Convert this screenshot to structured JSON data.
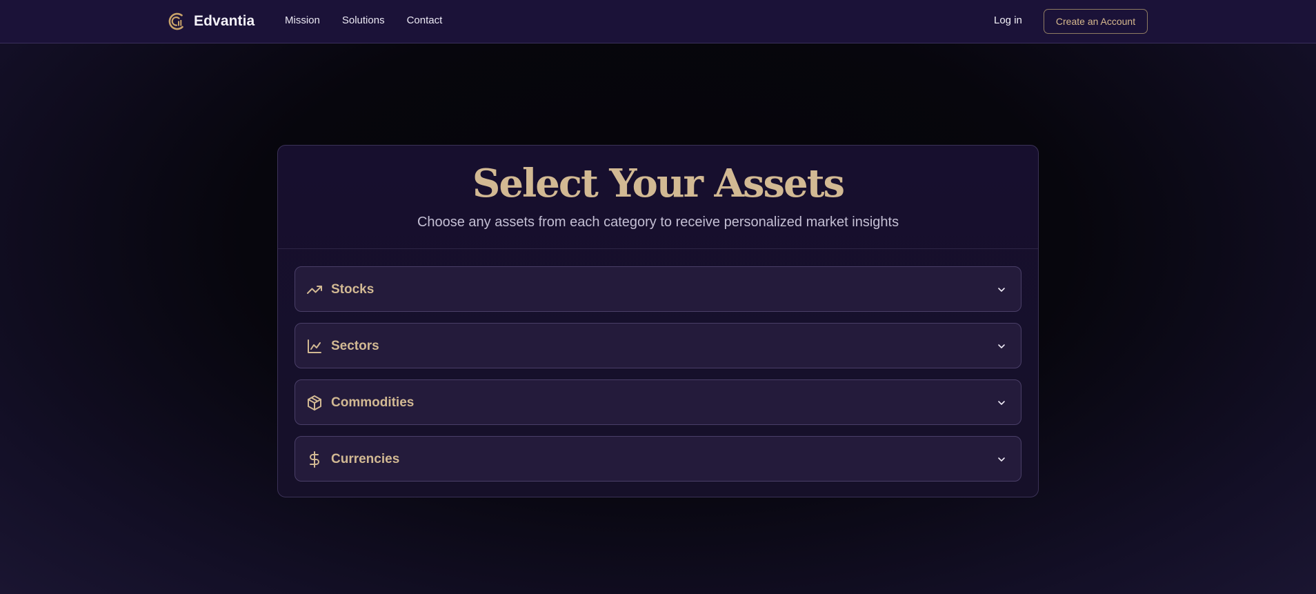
{
  "nav": {
    "brand": "Edvantia",
    "links": [
      "Mission",
      "Solutions",
      "Contact"
    ],
    "login": "Log in",
    "cta": "Create an Account"
  },
  "card": {
    "title": "Select Your Assets",
    "subtitle": "Choose any assets from each category to receive personalized market insights",
    "categories": [
      {
        "label": "Stocks",
        "icon": "trending-up-icon"
      },
      {
        "label": "Sectors",
        "icon": "line-chart-icon"
      },
      {
        "label": "Commodities",
        "icon": "package-icon"
      },
      {
        "label": "Currencies",
        "icon": "dollar-sign-icon"
      }
    ]
  },
  "colors": {
    "accent_gold": "#d2b993",
    "nav_bg": "#1b1238",
    "card_bg": "#170f2e",
    "accordion_bg": "#241b3b"
  }
}
